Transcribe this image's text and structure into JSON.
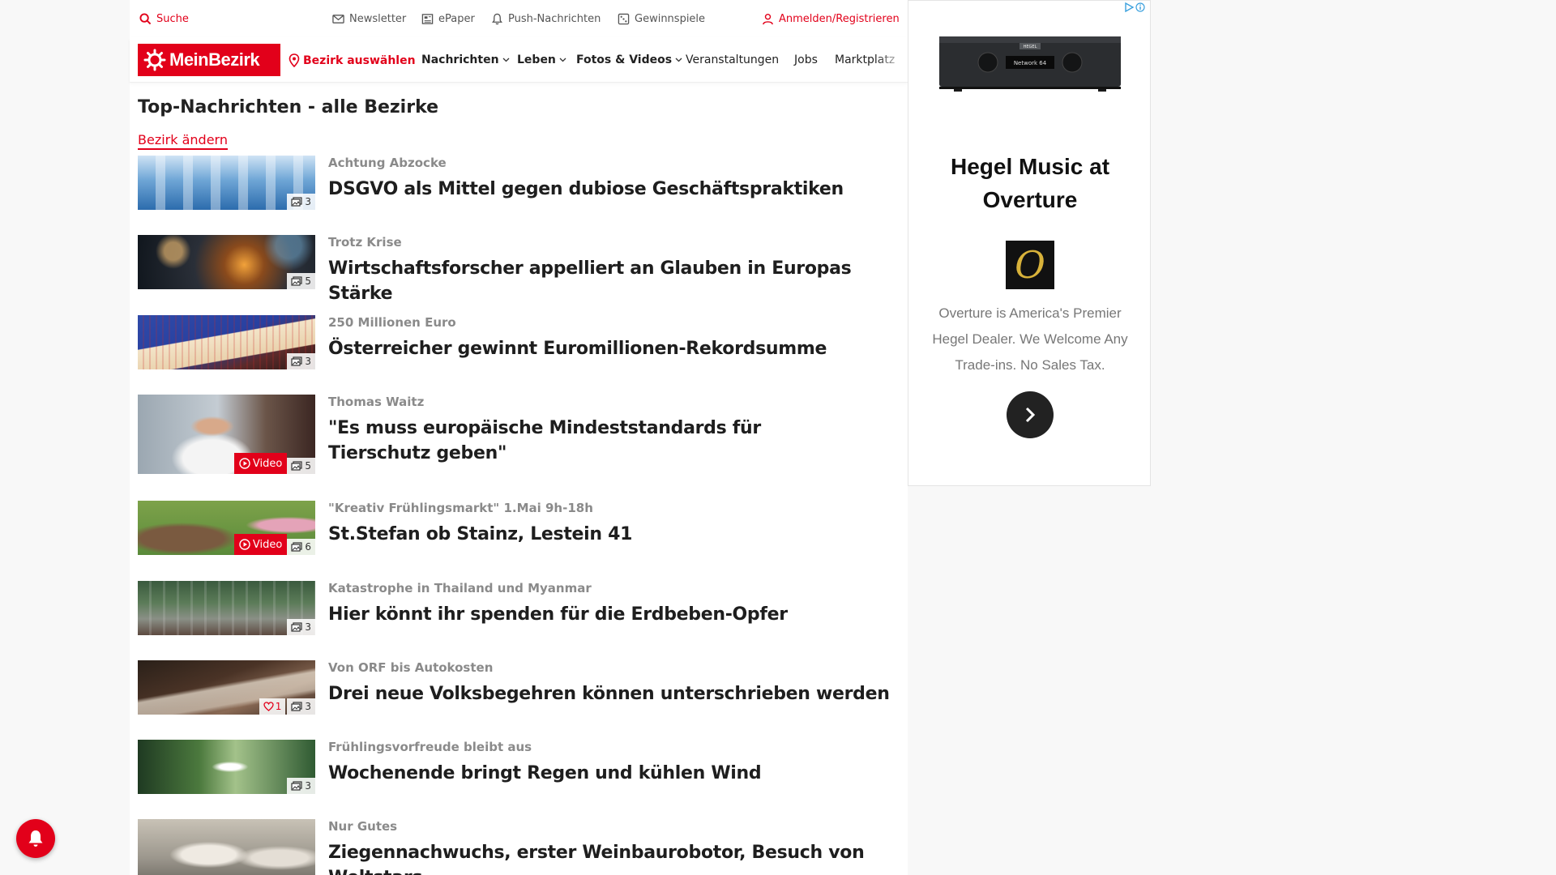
{
  "utility": {
    "search": "Suche",
    "newsletter": "Newsletter",
    "epaper": "ePaper",
    "push": "Push-Nachrichten",
    "contests": "Gewinnspiele",
    "login": "Anmelden/Registrieren"
  },
  "nav": {
    "logo": "MeinBezirk",
    "district": "Bezirk auswählen",
    "items": [
      "Nachrichten",
      "Leben",
      "Fotos & Videos",
      "Veranstaltungen",
      "Jobs",
      "Marktplatz"
    ]
  },
  "page": {
    "title": "Top-Nachrichten - alle Bezirke",
    "change_district": "Bezirk ändern"
  },
  "articles": [
    {
      "kicker": "Achtung Abzocke",
      "headline": "DSGVO als Mittel gegen dubiose Geschäftspraktiken",
      "images": "3"
    },
    {
      "kicker": "Trotz Krise",
      "headline": "Wirtschaftsforscher appelliert an Glauben in Europas Stärke",
      "images": "5"
    },
    {
      "kicker": "250 Millionen Euro",
      "headline": "Österreicher gewinnt Euromillionen-Rekordsumme",
      "images": "3"
    },
    {
      "kicker": "Thomas Waitz",
      "headline": "\"Es muss europäische Mindeststandards für Tierschutz geben\"",
      "images": "5",
      "video": "Video"
    },
    {
      "kicker": "\"Kreativ Frühlingsmarkt\" 1.Mai 9h-18h",
      "headline": "St.Stefan ob Stainz, Lestein 41",
      "images": "6",
      "video": "Video"
    },
    {
      "kicker": "Katastrophe in Thailand und Myanmar",
      "headline": "Hier könnt ihr spenden für die Erdbeben-Opfer",
      "images": "3"
    },
    {
      "kicker": "Von ORF bis Autokosten",
      "headline": "Drei neue Volksbegehren können unterschrieben werden",
      "images": "3",
      "likes": "1"
    },
    {
      "kicker": "Frühlingsvorfreude bleibt aus",
      "headline": "Wochenende bringt Regen und kühlen Wind",
      "images": "3"
    },
    {
      "kicker": "Nur Gutes",
      "headline": "Ziegennachwuchs, erster Weinbaurobotor, Besuch von Weltstars"
    }
  ],
  "ad": {
    "title": "Hegel Music at Overture",
    "body": "Overture is America's Premier Hegel Dealer. We Welcome Any Trade-ins. No Sales Tax.",
    "brand_letter": "O",
    "device_brand": "HEGEL",
    "device_display": "Network 64"
  },
  "colors": {
    "brand": "#e2001a",
    "kicker": "#8a8a8a",
    "headline": "#1e1e1e"
  }
}
